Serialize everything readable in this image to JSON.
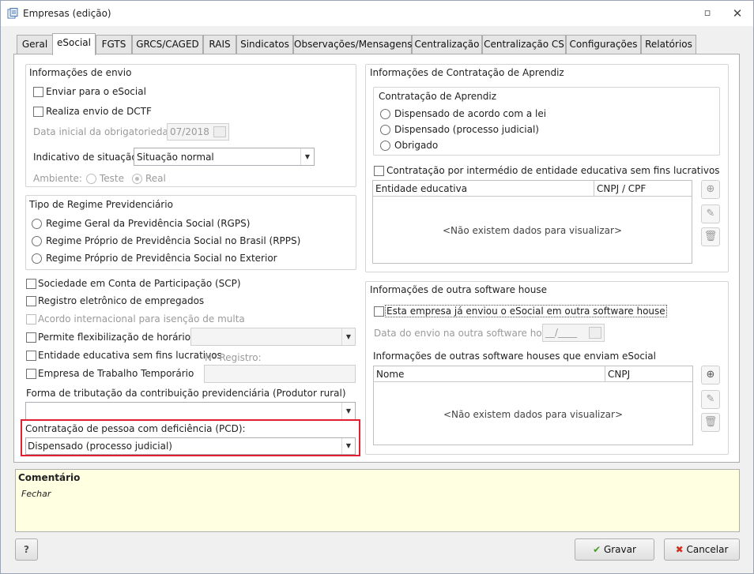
{
  "window": {
    "title": "Empresas (edição)",
    "restore_icon": "restore-icon",
    "close_icon": "close-icon"
  },
  "tabs": [
    {
      "label": "Geral"
    },
    {
      "label": "eSocial",
      "active": true
    },
    {
      "label": "FGTS"
    },
    {
      "label": "GRCS/CAGED"
    },
    {
      "label": "RAIS"
    },
    {
      "label": "Sindicatos"
    },
    {
      "label": "Observações/Mensagens"
    },
    {
      "label": "Centralização"
    },
    {
      "label": "Centralização CS"
    },
    {
      "label": "Configurações"
    },
    {
      "label": "Relatórios"
    }
  ],
  "envio": {
    "title": "Informações de envio",
    "enviar_label": "Enviar para o eSocial",
    "dctf_label": "Realiza envio de DCTF",
    "data_label": "Data inicial da obrigatoriedade:",
    "data_value": "07/2018",
    "indicativo_label": "Indicativo de situação:",
    "indicativo_value": "Situação normal",
    "ambiente_label": "Ambiente:",
    "teste_label": "Teste",
    "real_label": "Real"
  },
  "regime": {
    "title": "Tipo de Regime Previdenciário",
    "options": [
      "Regime Geral da Previdência Social (RGPS)",
      "Regime Próprio de Previdência Social no Brasil (RPPS)",
      "Regime Próprio de Previdência Social no Exterior"
    ]
  },
  "flags": {
    "scp": "Sociedade em Conta de Participação (SCP)",
    "registro": "Registro eletrônico de empregados",
    "acordo": "Acordo internacional para isenção de multa",
    "flex": "Permite flexibilização de horários",
    "entidade": "Entidade educativa sem fins lucrativos",
    "registro_num_label": "Nº Registro:",
    "temporario": "Empresa de Trabalho Temporário",
    "tributacao_label": "Forma de tributação da contribuição previdenciária (Produtor rural)",
    "tributacao_value": "",
    "pcd_label": "Contratação de pessoa com deficiência (PCD):",
    "pcd_value": "Dispensado (processo judicial)"
  },
  "aprendiz": {
    "title": "Informações de Contratação de Aprendiz",
    "sub_title": "Contratação de Aprendiz",
    "options": [
      "Dispensado de acordo com a lei",
      "Dispensado (processo judicial)",
      "Obrigado"
    ],
    "intermedio_label": "Contratação por intermédio de entidade educativa sem fins lucrativos",
    "grid_cols": [
      "Entidade educativa",
      "CNPJ / CPF"
    ],
    "empty_text": "<Não existem dados para visualizar>"
  },
  "software": {
    "title": "Informações de outra software house",
    "enviou_label": "Esta empresa já enviou o eSocial em outra software house",
    "data_label": "Data do envio na outra software house:",
    "data_value": "__/____",
    "outras_label": "Informações de outras software houses que enviam eSocial",
    "grid_cols": [
      "Nome",
      "CNPJ"
    ],
    "empty_text": "<Não existem dados para visualizar>"
  },
  "comment": {
    "title": "Comentário",
    "text": "Fechar"
  },
  "footer": {
    "help": "?",
    "save_label": "Gravar",
    "cancel_label": "Cancelar"
  },
  "colors": {
    "highlight": "#e02030",
    "comment_bg": "#ffffe1"
  }
}
